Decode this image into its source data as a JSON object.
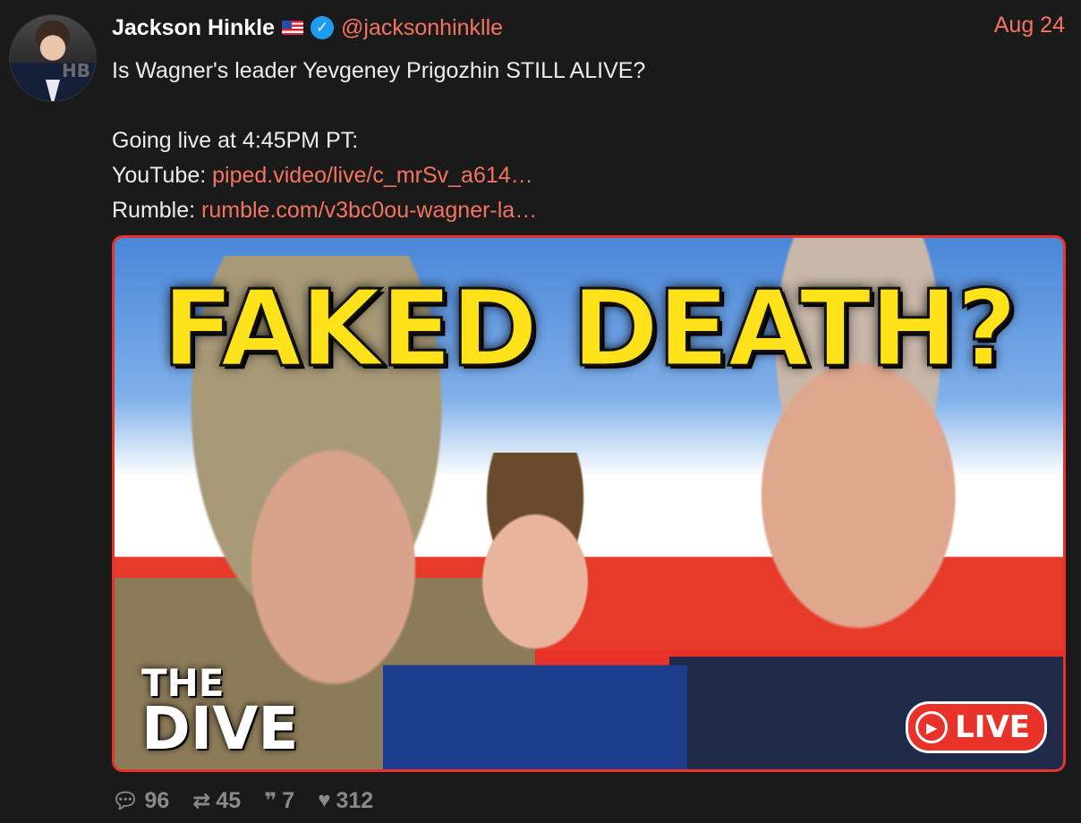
{
  "author": {
    "name": "Jackson Hinkle",
    "flag_icon": "us-flag-icon",
    "verified_icon": "verified-badge-icon",
    "handle": "@jacksonhinklle",
    "avatar_text": "HB"
  },
  "date": "Aug 24",
  "text": {
    "line1": "Is Wagner's leader Yevgeney Prigozhin STILL ALIVE?",
    "line2": "Going live at 4:45PM PT:",
    "youtube_label": "YouTube: ",
    "youtube_link": "piped.video/live/c_mrSv_a614…",
    "rumble_label": "Rumble: ",
    "rumble_link": "rumble.com/v3bc0ou-wagner-la…"
  },
  "media": {
    "headline": "FAKED DEATH?",
    "brand_line1": "THE",
    "brand_line2": "DIVE",
    "live_label": "LIVE"
  },
  "stats": {
    "replies": "96",
    "retweets": "45",
    "quotes": "7",
    "likes": "312"
  },
  "colors": {
    "accent": "#f5735f",
    "background": "#1a1a1a",
    "headline": "#ffe21a",
    "live_red": "#e8322a"
  }
}
